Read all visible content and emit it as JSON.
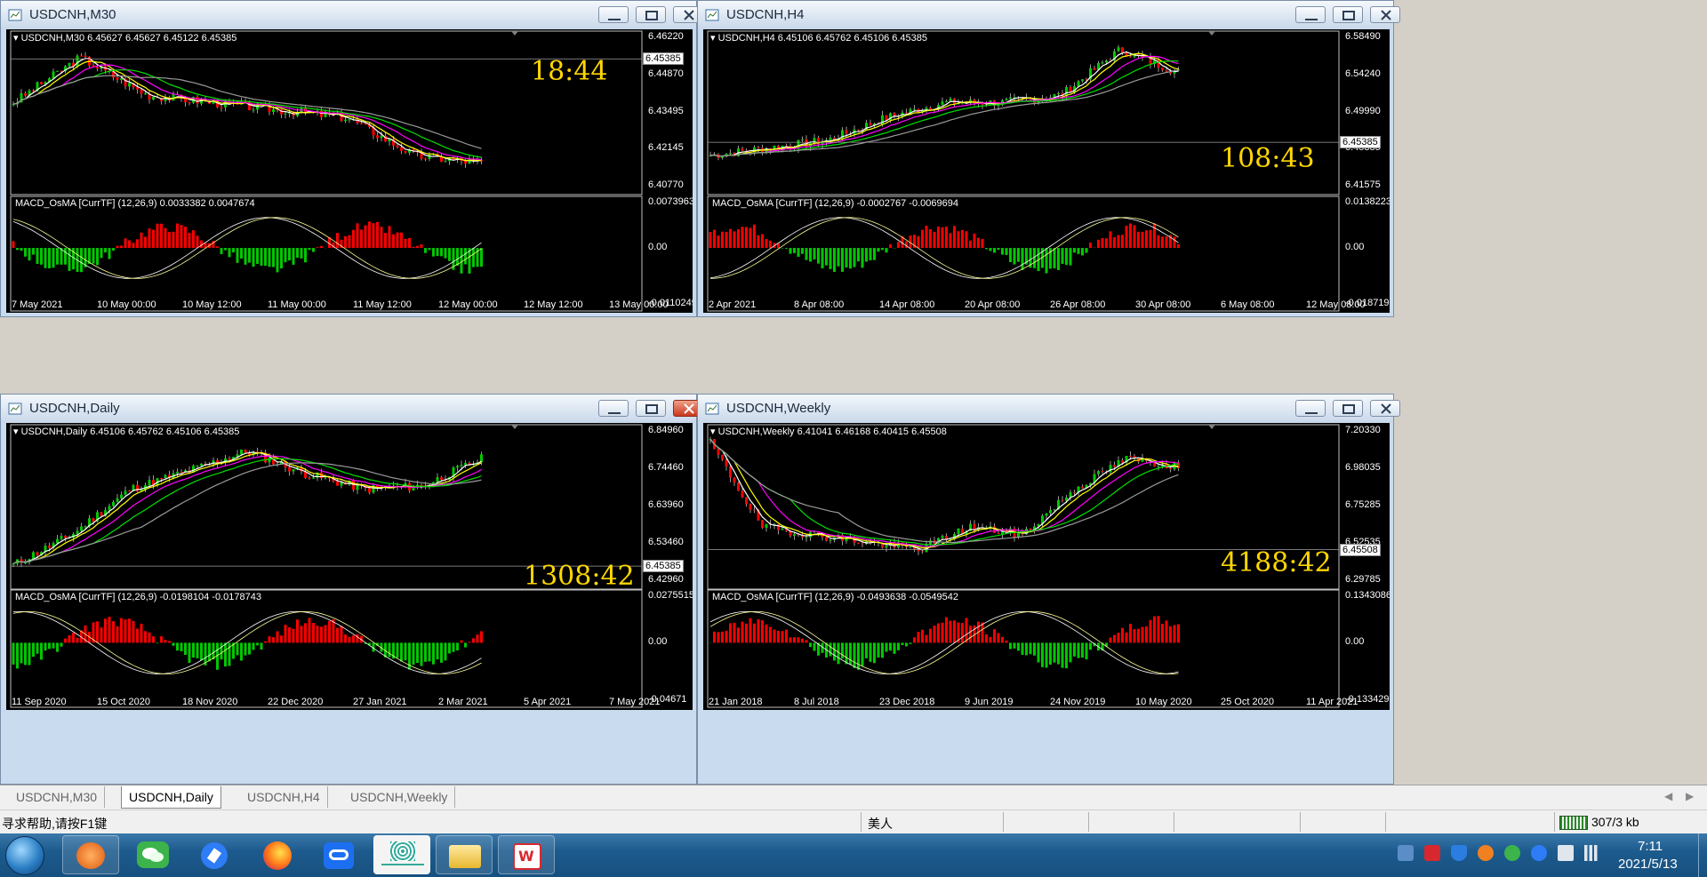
{
  "windows": [
    {
      "title": "USDCNH,M30",
      "header": "USDCNH,M30  6.45627 6.45627 6.45122 6.45385",
      "clock": "18:44",
      "price_ticks": [
        "6.46220",
        "6.44870",
        "6.43495",
        "6.42145",
        "6.40770"
      ],
      "current_price": "6.45385",
      "macd_label": "MACD_OsMA [CurrTF] (12,26,9) 0.0033382 0.0047674",
      "macd_ticks": [
        "0.0073963",
        "0.00",
        "-0.0110249"
      ],
      "time_ticks": [
        "7 May 2021",
        "10 May 00:00",
        "10 May 12:00",
        "11 May 00:00",
        "11 May 12:00",
        "12 May 00:00",
        "12 May 12:00",
        "13 May 00:00"
      ]
    },
    {
      "title": "USDCNH,H4",
      "header": "USDCNH,H4  6.45106 6.45762 6.45106 6.45385",
      "clock": "108:43",
      "price_ticks": [
        "6.58490",
        "6.54240",
        "6.49990",
        "6.45385",
        "6.41575"
      ],
      "current_price": "6.45385",
      "macd_label": "MACD_OsMA [CurrTF] (12,26,9) -0.0002767 -0.0069694",
      "macd_ticks": [
        "0.0138223",
        "0.00",
        "-0.0187195"
      ],
      "time_ticks": [
        "2 Apr 2021",
        "8 Apr 08:00",
        "14 Apr 08:00",
        "20 Apr 08:00",
        "26 Apr 08:00",
        "30 Apr 08:00",
        "6 May 08:00",
        "12 May 08:00"
      ]
    },
    {
      "title": "USDCNH,Daily",
      "header": "USDCNH,Daily  6.45106 6.45762 6.45106 6.45385",
      "clock": "1308:42",
      "price_ticks": [
        "6.84960",
        "6.74460",
        "6.63960",
        "6.53460",
        "6.42960"
      ],
      "current_price": "6.45385",
      "macd_label": "MACD_OsMA [CurrTF] (12,26,9) -0.0198104 -0.0178743",
      "macd_ticks": [
        "0.0275515",
        "0.00",
        "-0.04671"
      ],
      "time_ticks": [
        "11 Sep 2020",
        "15 Oct 2020",
        "18 Nov 2020",
        "22 Dec 2020",
        "27 Jan 2021",
        "2 Mar 2021",
        "5 Apr 2021",
        "7 May 2021"
      ]
    },
    {
      "title": "USDCNH,Weekly",
      "header": "USDCNH,Weekly  6.41041 6.46168 6.40415 6.45508",
      "clock": "4188:42",
      "price_ticks": [
        "7.20330",
        "6.98035",
        "6.75285",
        "6.52535",
        "6.29785"
      ],
      "current_price": "6.45508",
      "macd_label": "MACD_OsMA [CurrTF] (12,26,9) -0.0493638 -0.0549542",
      "macd_ticks": [
        "0.1343086",
        "0.00",
        "-0.1334299"
      ],
      "time_ticks": [
        "21 Jan 2018",
        "8 Jul 2018",
        "23 Dec 2018",
        "9 Jun 2019",
        "24 Nov 2019",
        "10 May 2020",
        "25 Oct 2020",
        "11 Apr 2021"
      ]
    }
  ],
  "tabs": [
    "USDCNH,M30",
    "USDCNH,Daily",
    "USDCNH,H4",
    "USDCNH,Weekly"
  ],
  "active_tab": "USDCNH,Daily",
  "status": {
    "help": "寻求帮助,请按F1键",
    "profile": "美人",
    "traffic": "307/3 kb"
  },
  "clock": {
    "time": "7:11",
    "date": "2021/5/13"
  },
  "taskbar_icons": [
    "start-orb-icon",
    "app-orange-icon",
    "wechat-icon",
    "feishu-icon",
    "firefox-icon",
    "tencent-meeting-icon",
    "app-logo-icon",
    "folder-icon",
    "wps-icon"
  ],
  "colors": {
    "candle_up": "#00c800",
    "candle_down": "#ff0000",
    "ma_white": "#ffffff",
    "ma_yellow": "#ffff00",
    "ma_magenta": "#ff00ff",
    "ma_green": "#00e000",
    "ma_gray": "#9a9a9a",
    "clock": "#ffd700"
  }
}
